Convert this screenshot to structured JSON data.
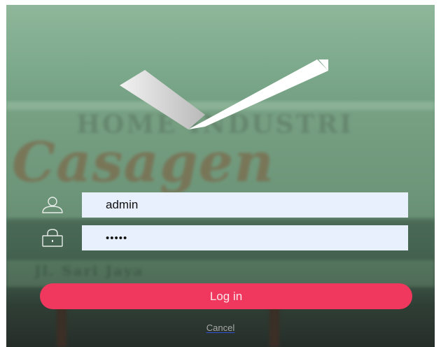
{
  "login": {
    "username_value": "admin",
    "password_value": "•••••",
    "login_label": "Log in",
    "cancel_label": "Cancel"
  },
  "background": {
    "line1": "HOME INDUSTRI",
    "line2": "Casagen",
    "line3": "Jl. Sari Jaya"
  },
  "colors": {
    "accent": "#f0385e",
    "input_bg": "#e8f0fe",
    "logo": "#ffffff"
  },
  "icons": {
    "user": "user-icon",
    "lock": "lock-icon",
    "logo": "checkmark-logo"
  }
}
